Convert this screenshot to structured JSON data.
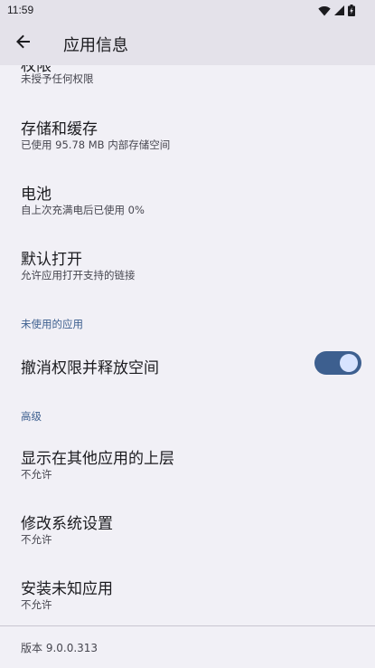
{
  "status_bar": {
    "time": "11:59",
    "icons": [
      "wifi-icon",
      "cell-signal-icon",
      "battery-icon"
    ]
  },
  "app_bar": {
    "back_icon": "arrow-left-icon",
    "title": "应用信息"
  },
  "clipped_item": {
    "title": "权限",
    "summary": "未授予任何权限"
  },
  "storage": {
    "title": "存储和缓存",
    "summary": "已使用 95.78 MB 内部存储空间"
  },
  "battery": {
    "title": "电池",
    "summary": "自上次充满电后已使用 0%"
  },
  "open_default": {
    "title": "默认打开",
    "summary": "允许应用打开支持的链接"
  },
  "unused_apps": {
    "category": "未使用的应用",
    "toggle_title": "撤消权限并释放空间",
    "toggle_on": true
  },
  "advanced": {
    "category": "高级",
    "items": [
      {
        "title": "显示在其他应用的上层",
        "summary": "不允许"
      },
      {
        "title": "修改系统设置",
        "summary": "不允许"
      },
      {
        "title": "安装未知应用",
        "summary": "不允许"
      }
    ]
  },
  "footer": {
    "version": "版本 9.0.0.313"
  },
  "colors": {
    "background": "#f1f0f6",
    "app_bar": "#e4e2ea",
    "accent": "#3d5f8f",
    "toggle_thumb": "#d7e3ff"
  }
}
